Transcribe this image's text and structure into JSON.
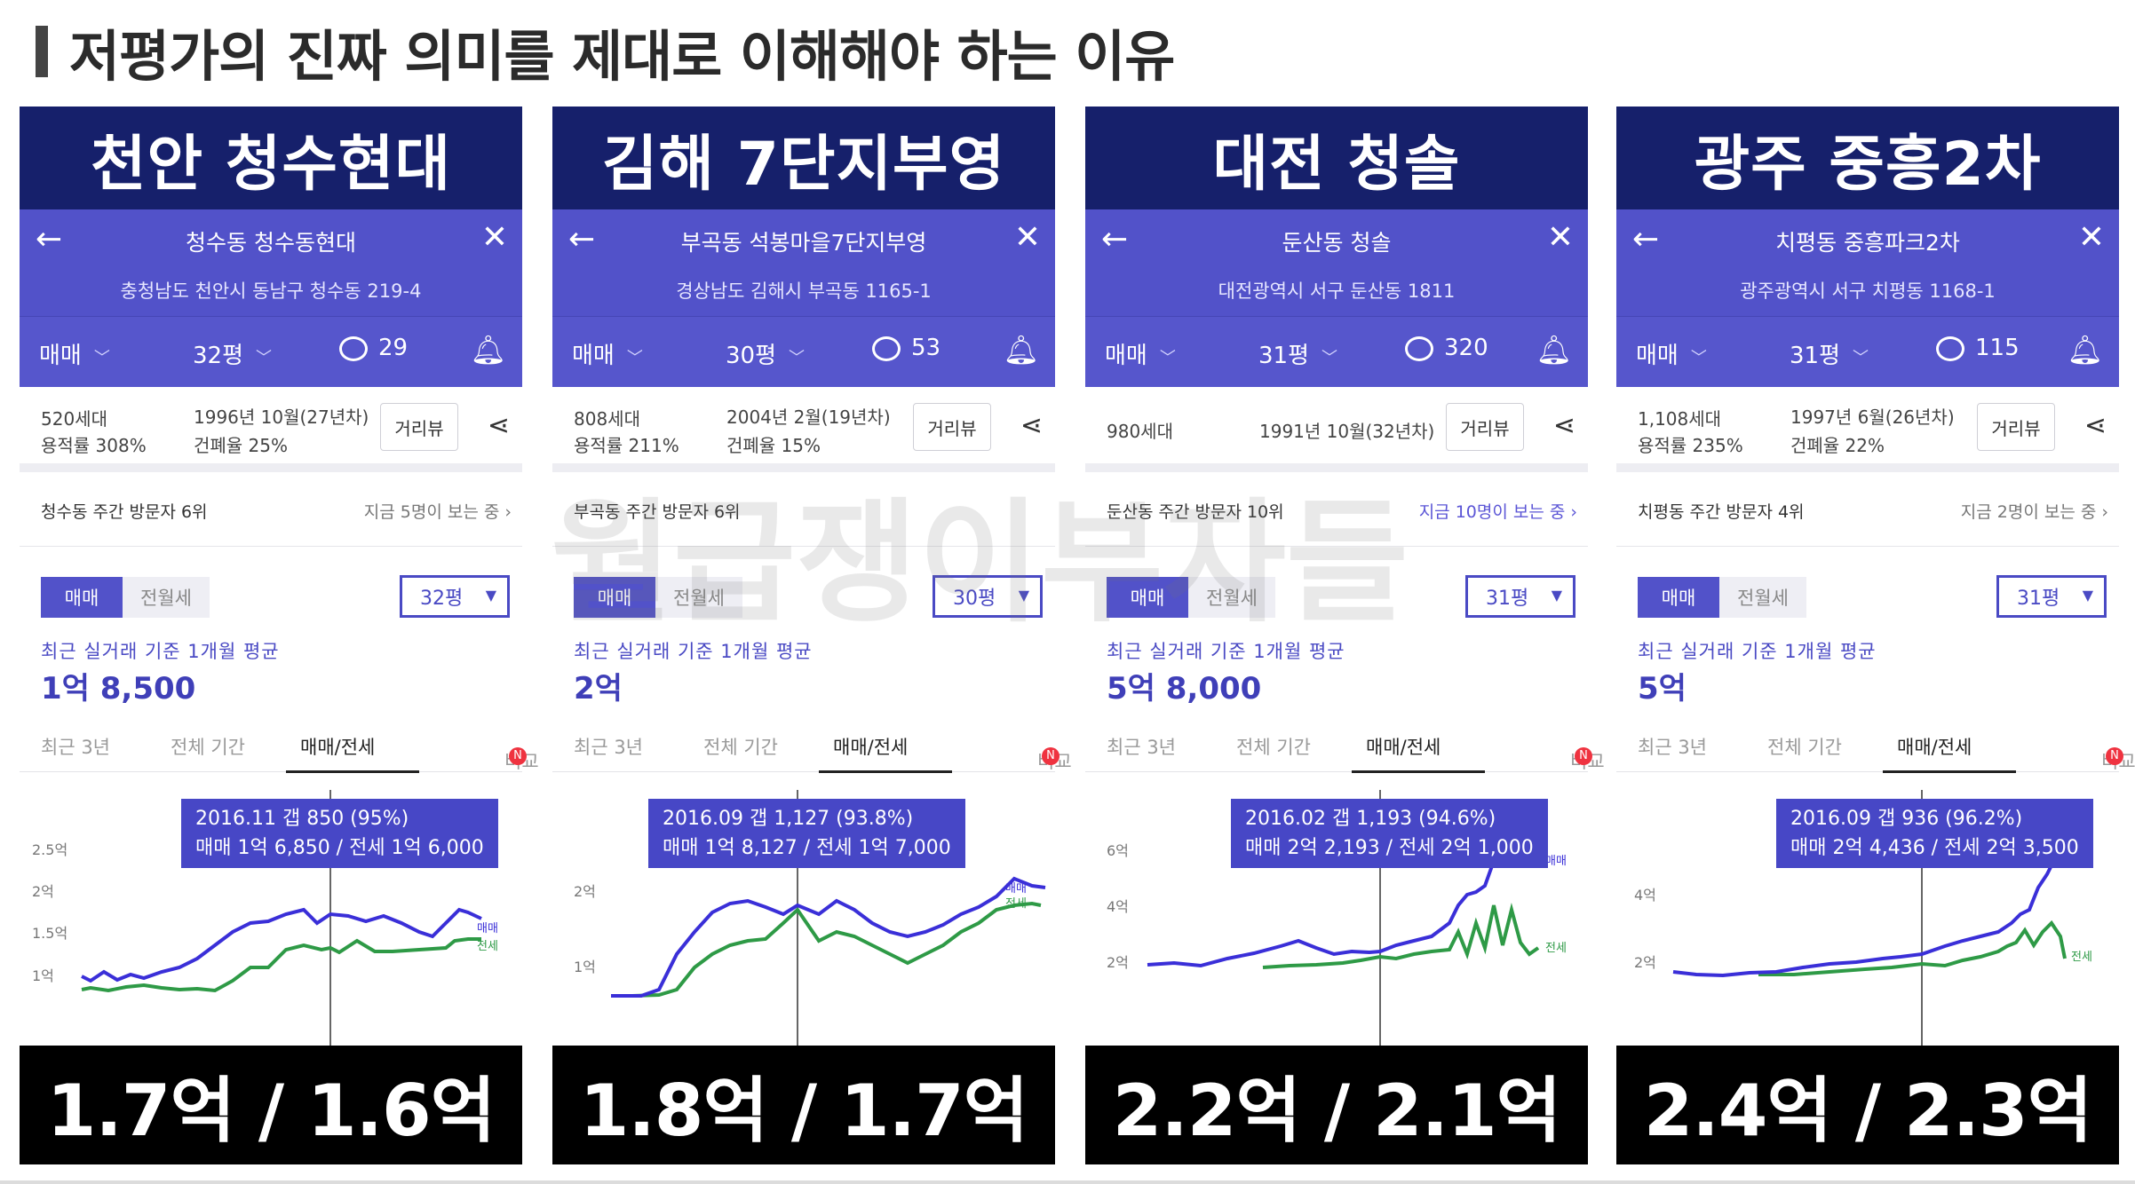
{
  "slide": {
    "title": "저평가의 진짜 의미를 제대로 이해해야 하는 이유",
    "watermark": "월급쟁이부자들"
  },
  "common": {
    "back_icon": "←",
    "close_icon": "✕",
    "tab_trade": "매매",
    "bell_icon": "🔔",
    "share_icon": "⋖",
    "review_btn": "거리뷰",
    "tab_sale": "매매",
    "tab_jeonse": "전월세",
    "avg_label": "최근 실거래 기준 1개월 평균",
    "period_3y": "최근 3년",
    "period_all": "전체 기간",
    "period_sj": "매매/전세",
    "period_compare": "비교",
    "compare_badge": "N",
    "legend_sale": "매매",
    "legend_jeonse": "전세",
    "colors": {
      "header_navy": "#16206b",
      "app_purple": "#5252c9",
      "sale_line": "#3a2fd8",
      "jeonse_line": "#2e9a46",
      "answer_bg": "#000000"
    }
  },
  "panels": [
    {
      "header": "천안 청수현대",
      "apt_name": "청수동 청수동현대",
      "address": "충청남도 천안시 동남구 청수동 219-4",
      "size_tab": "32평",
      "comments": "29",
      "units": "520세대",
      "far": "용적률 308%",
      "built": "1996년 10월(27년차)",
      "bcr": "건폐율 25%",
      "visitors": "청수동 주간 방문자 6위",
      "now_viewing": "지금 5명이 보는 중 ›",
      "size_select": "32평",
      "avg_price": "1억 8,500",
      "tooltip_line1": "2016.11  갭 850 (95%)",
      "tooltip_line2": "매매 1억 6,850 / 전세 1억 6,000",
      "y_ticks": [
        "2.5억",
        "2억",
        "1.5억",
        "1억"
      ],
      "answer": "1.7억 / 1.6억"
    },
    {
      "header": "김해 7단지부영",
      "apt_name": "부곡동 석봉마을7단지부영",
      "address": "경상남도 김해시 부곡동 1165-1",
      "size_tab": "30평",
      "comments": "53",
      "units": "808세대",
      "far": "용적률 211%",
      "built": "2004년 2월(19년차)",
      "bcr": "건폐율 15%",
      "visitors": "부곡동 주간 방문자 6위",
      "now_viewing": "",
      "size_select": "30평",
      "avg_price": "2억",
      "tooltip_line1": "2016.09  갭 1,127 (93.8%)",
      "tooltip_line2": "매매 1억 8,127 / 전세 1억 7,000",
      "y_ticks": [
        "2억",
        "1억"
      ],
      "answer": "1.8억 / 1.7억"
    },
    {
      "header": "대전 청솔",
      "apt_name": "둔산동 청솔",
      "address": "대전광역시 서구 둔산동 1811",
      "size_tab": "31평",
      "comments": "320",
      "units": "980세대",
      "far": "",
      "built": "1991년 10월(32년차)",
      "bcr": "",
      "visitors": "둔산동 주간 방문자 10위",
      "now_viewing": "지금 10명이 보는 중 ›",
      "size_select": "31평",
      "avg_price": "5억 8,000",
      "tooltip_line1": "2016.02  갭 1,193 (94.6%)",
      "tooltip_line2": "매매 2억 2,193 / 전세 2억 1,000",
      "y_ticks": [
        "6억",
        "4억",
        "2억"
      ],
      "answer": "2.2억 / 2.1억"
    },
    {
      "header": "광주 중흥2차",
      "apt_name": "치평동 중흥파크2차",
      "address": "광주광역시 서구 치평동 1168-1",
      "size_tab": "31평",
      "comments": "115",
      "units": "1,108세대",
      "far": "용적률 235%",
      "built": "1997년 6월(26년차)",
      "bcr": "건폐율 22%",
      "visitors": "치평동 주간 방문자 4위",
      "now_viewing": "지금 2명이 보는 중 ›",
      "size_select": "31평",
      "avg_price": "5억",
      "tooltip_line1": "2016.09  갭 936 (96.2%)",
      "tooltip_line2": "매매 2억 4,436 / 전세 2억 3,500",
      "y_ticks": [
        "4억",
        "2억"
      ],
      "answer": "2.4억 / 2.3억"
    }
  ]
}
